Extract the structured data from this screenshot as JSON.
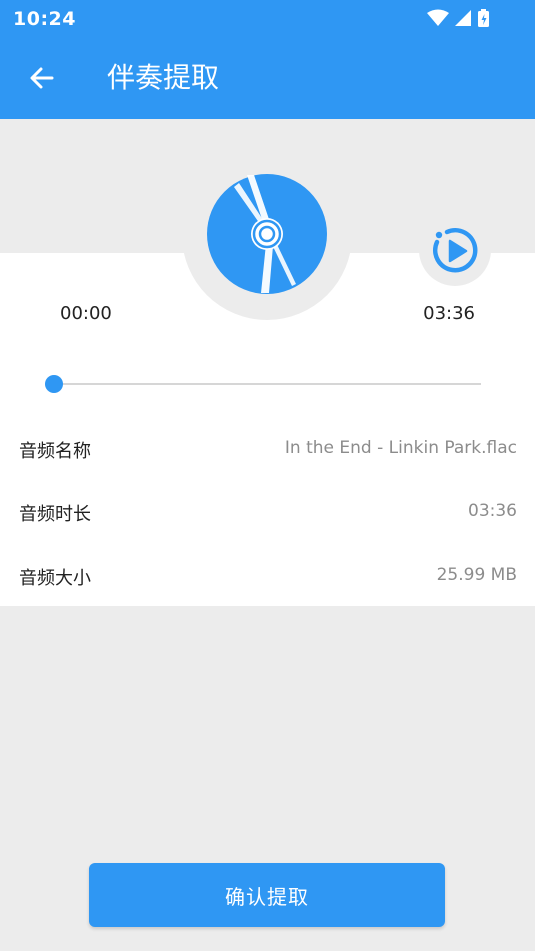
{
  "status_bar": {
    "time": "10:24",
    "icons": [
      "wifi-icon",
      "signal-icon",
      "battery-icon"
    ]
  },
  "app_bar": {
    "title": "伴奏提取",
    "back_icon": "arrow-left-icon"
  },
  "player": {
    "disc_icon": "disc-icon",
    "play_icon": "play-circle-icon",
    "current_time": "00:00",
    "total_time": "03:36",
    "progress": 0
  },
  "info": [
    {
      "label": "音频名称",
      "value": "In the End - Linkin Park.flac"
    },
    {
      "label": "音频时长",
      "value": "03:36"
    },
    {
      "label": "音频大小",
      "value": "25.99 MB"
    }
  ],
  "actions": {
    "confirm_label": "确认提取"
  },
  "colors": {
    "accent": "#2f97f3",
    "background": "#ececec",
    "card": "#ffffff"
  }
}
